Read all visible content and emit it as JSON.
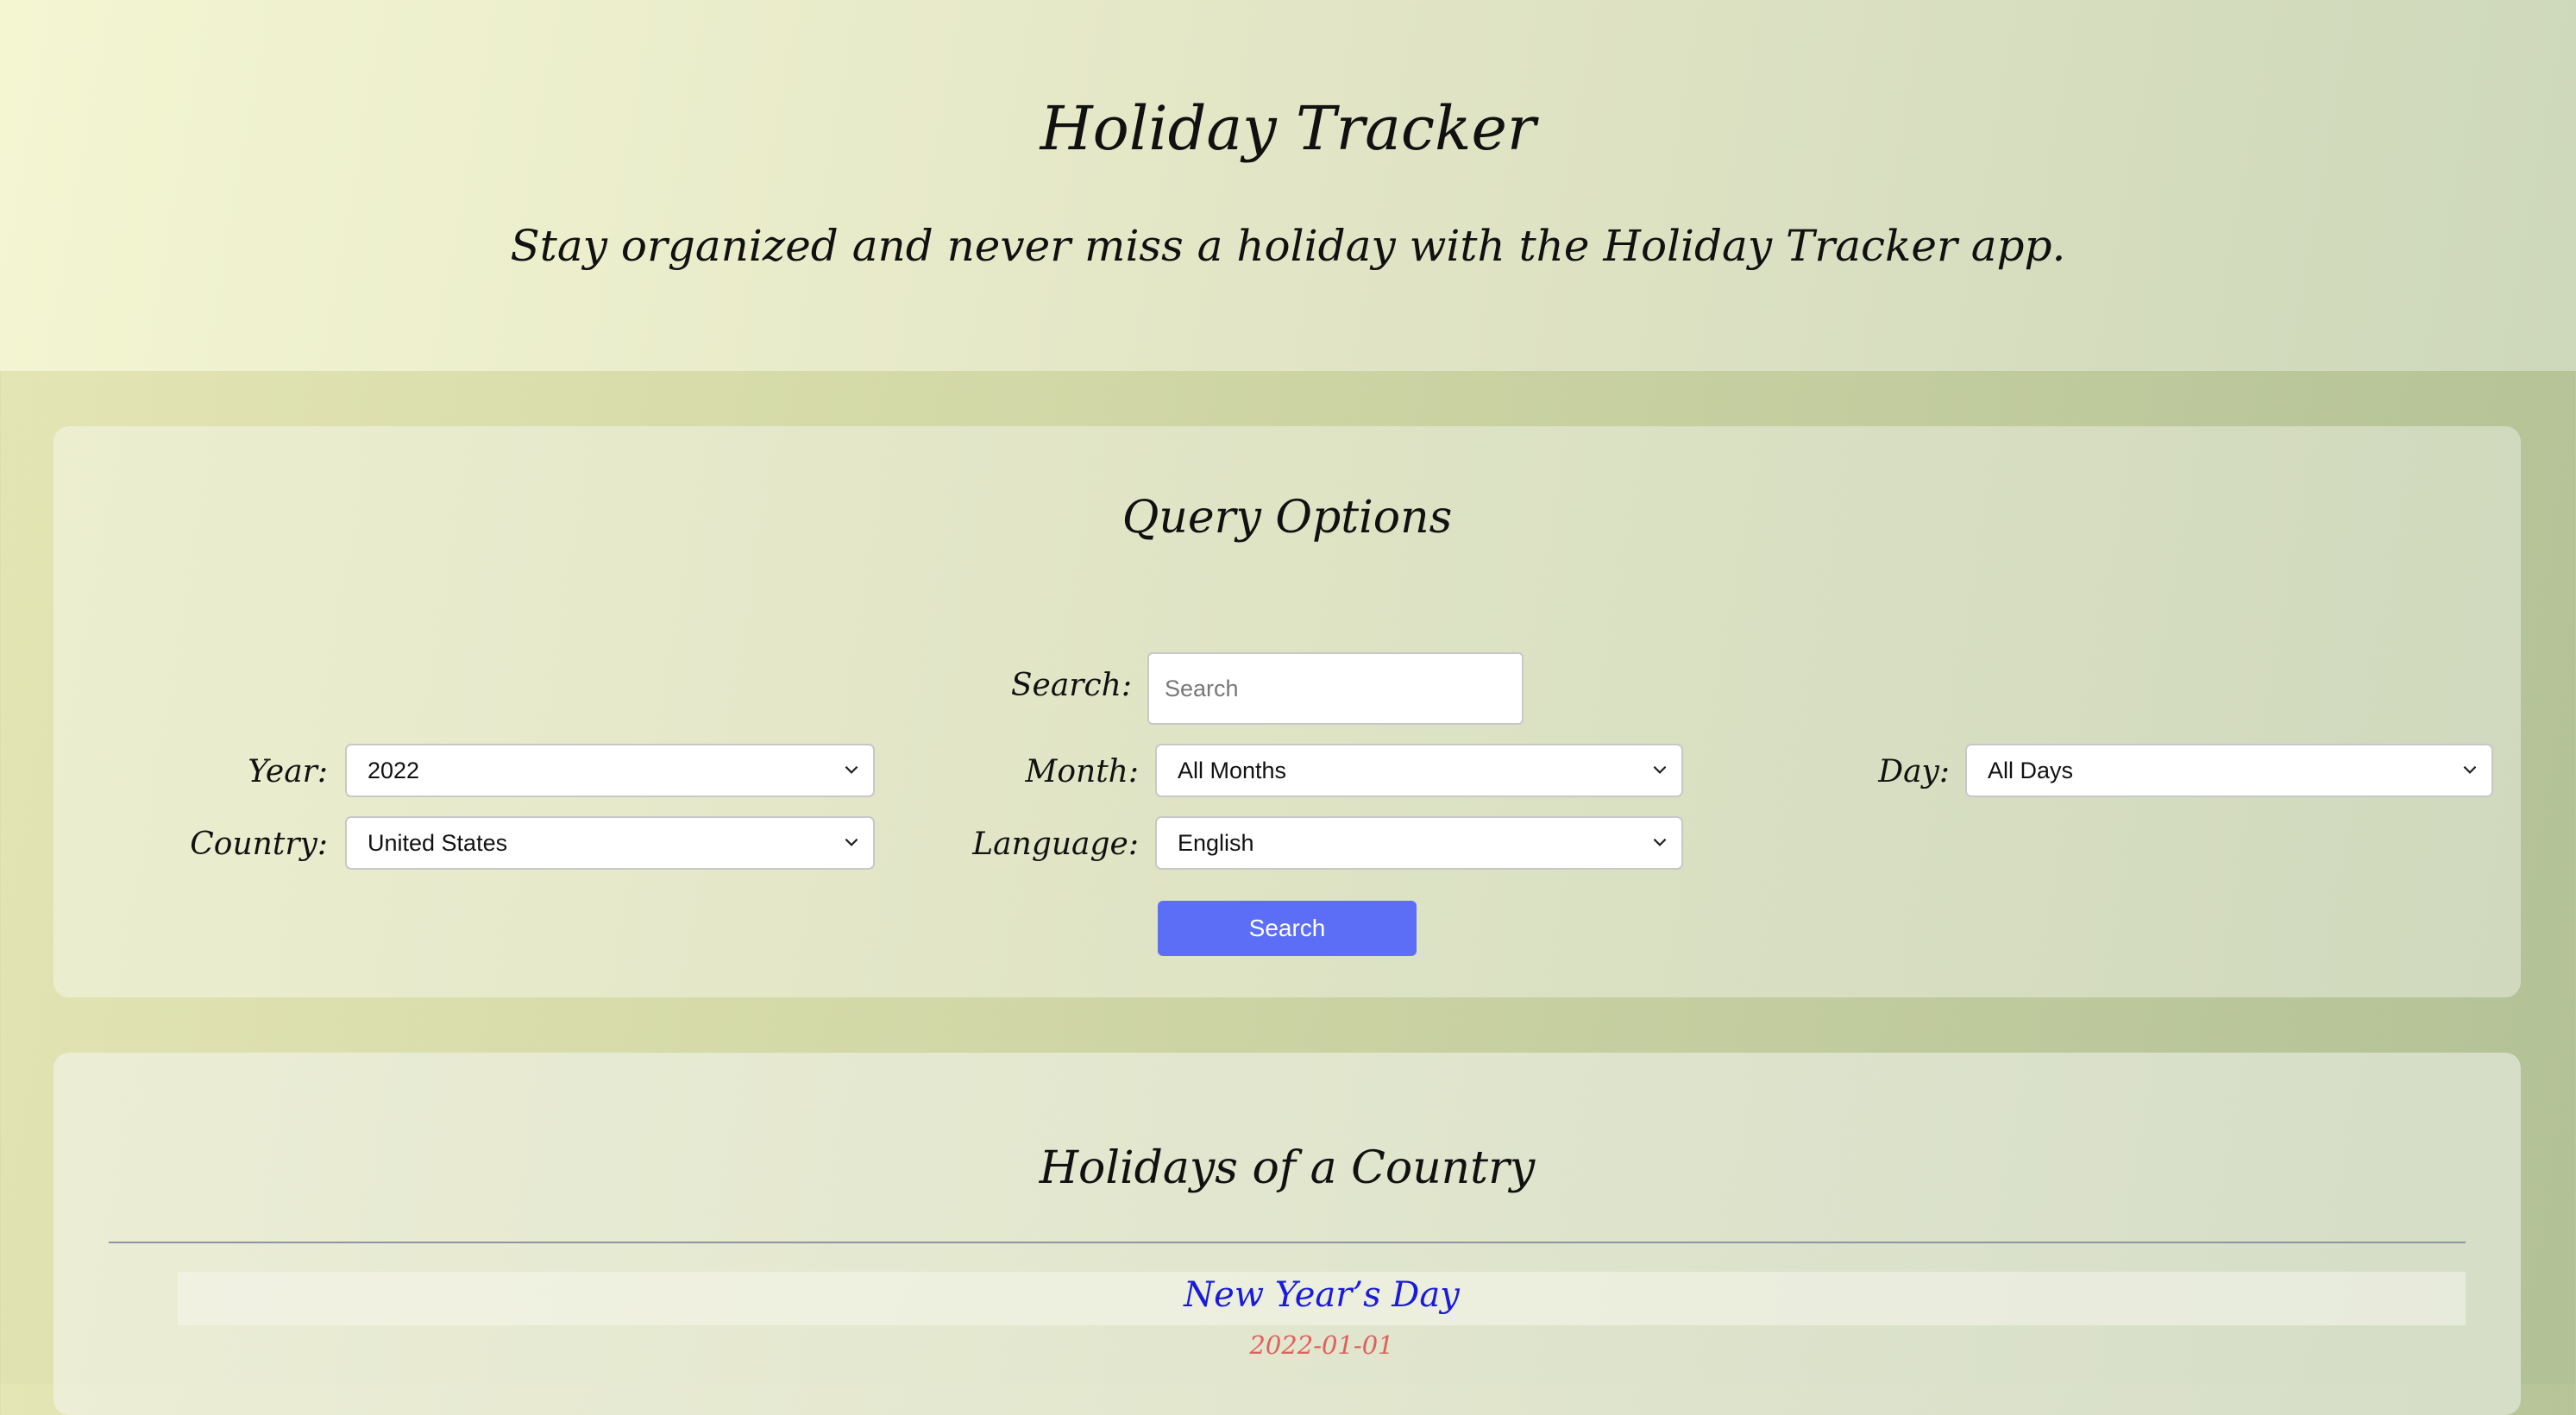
{
  "header": {
    "title": "Holiday Tracker",
    "subtitle": "Stay organized and never miss a holiday with the Holiday Tracker app."
  },
  "query": {
    "title": "Query Options",
    "search_label": "Search:",
    "search_placeholder": "Search",
    "year_label": "Year:",
    "year_value": "2022",
    "month_label": "Month:",
    "month_value": "All Months",
    "day_label": "Day:",
    "day_value": "All Days",
    "country_label": "Country:",
    "country_value": "United States",
    "language_label": "Language:",
    "language_value": "English",
    "search_button": "Search"
  },
  "results": {
    "title": "Holidays of a Country",
    "holidays": [
      {
        "name": "New Year’s Day",
        "date": "2022-01-01"
      }
    ]
  },
  "colors": {
    "button": "#5b6ef5",
    "holiday_name": "#1a1adc",
    "holiday_date": "#e06060"
  }
}
